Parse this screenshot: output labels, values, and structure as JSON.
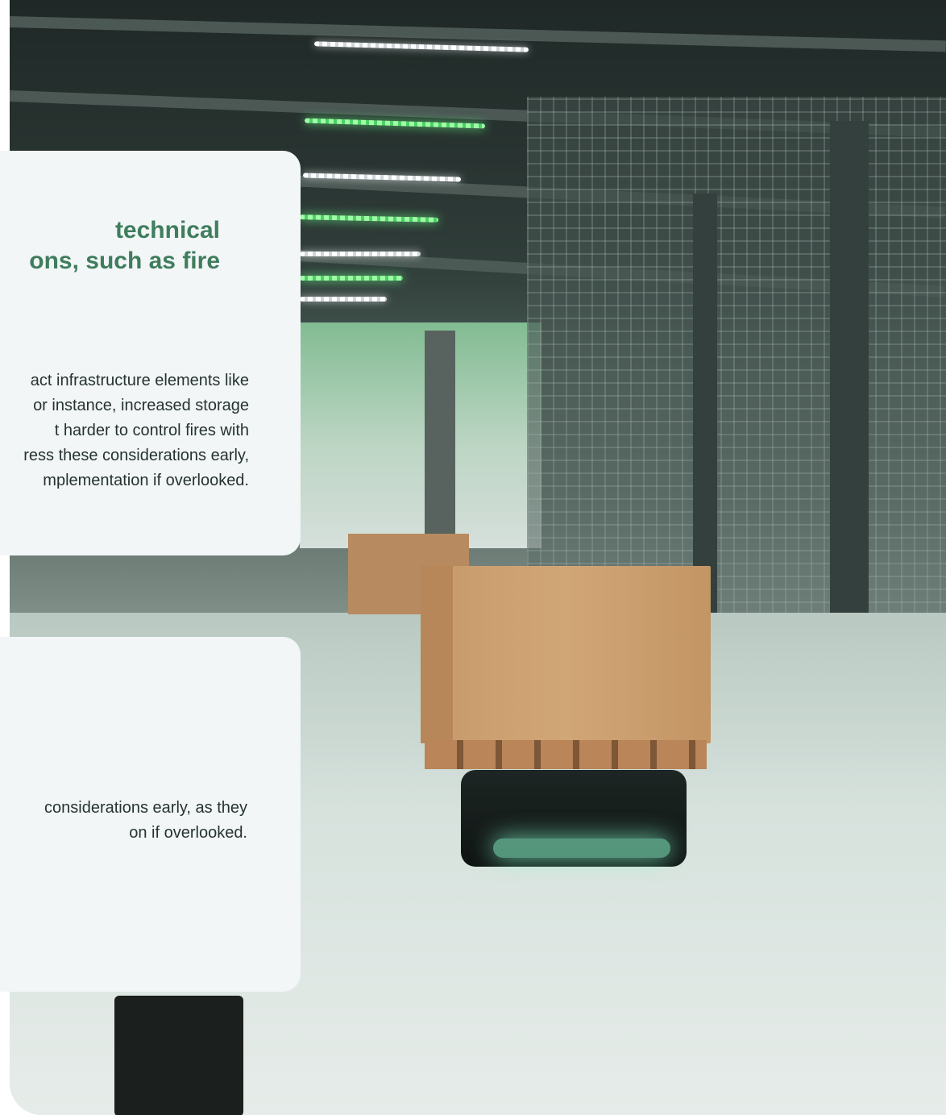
{
  "card_top": {
    "title_lines": [
      "technical",
      "ons, such as fire"
    ],
    "body_lines": [
      "act infrastructure elements like",
      "or instance, increased storage",
      "t harder to control fires with",
      "ress these considerations early,",
      "mplementation if overlooked."
    ]
  },
  "card_bottom": {
    "body_lines": [
      "considerations early, as they",
      "on if overlooked."
    ]
  },
  "colors": {
    "heading_green": "#3f7d5d",
    "card_background": "#f2f6f7",
    "body_text": "#263231"
  }
}
